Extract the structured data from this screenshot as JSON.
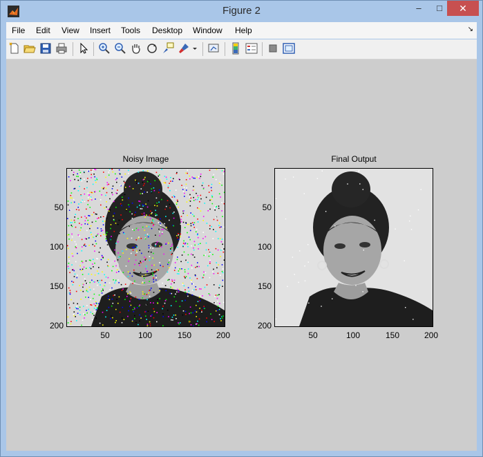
{
  "window": {
    "title": "Figure 2"
  },
  "menubar": {
    "items": [
      "File",
      "Edit",
      "View",
      "Insert",
      "Tools",
      "Desktop",
      "Window",
      "Help"
    ]
  },
  "toolbar": {
    "buttons": [
      "new-figure",
      "open-file",
      "save",
      "print",
      "edit-plot",
      "zoom-in",
      "zoom-out",
      "pan",
      "rotate-3d",
      "data-cursor",
      "brush",
      "link-plot",
      "insert-colorbar",
      "insert-legend",
      "hide-plot-tools",
      "show-plot-tools"
    ]
  },
  "axes": [
    {
      "title": "Noisy Image",
      "xticks": [
        "50",
        "100",
        "150",
        "200"
      ],
      "yticks": [
        "50",
        "100",
        "150",
        "200"
      ],
      "xlim": [
        1,
        200
      ],
      "ylim": [
        1,
        200
      ],
      "noise": "salt and pepper (color)"
    },
    {
      "title": "Final Output",
      "xticks": [
        "50",
        "100",
        "150",
        "200"
      ],
      "yticks": [
        "50",
        "100",
        "150",
        "200"
      ],
      "xlim": [
        1,
        200
      ],
      "ylim": [
        1,
        200
      ],
      "noise": "filtered"
    }
  ],
  "colors": {
    "figure_bg": "#cdcdcd",
    "titlebar": "#a9c6e8",
    "close_button": "#c75050"
  }
}
